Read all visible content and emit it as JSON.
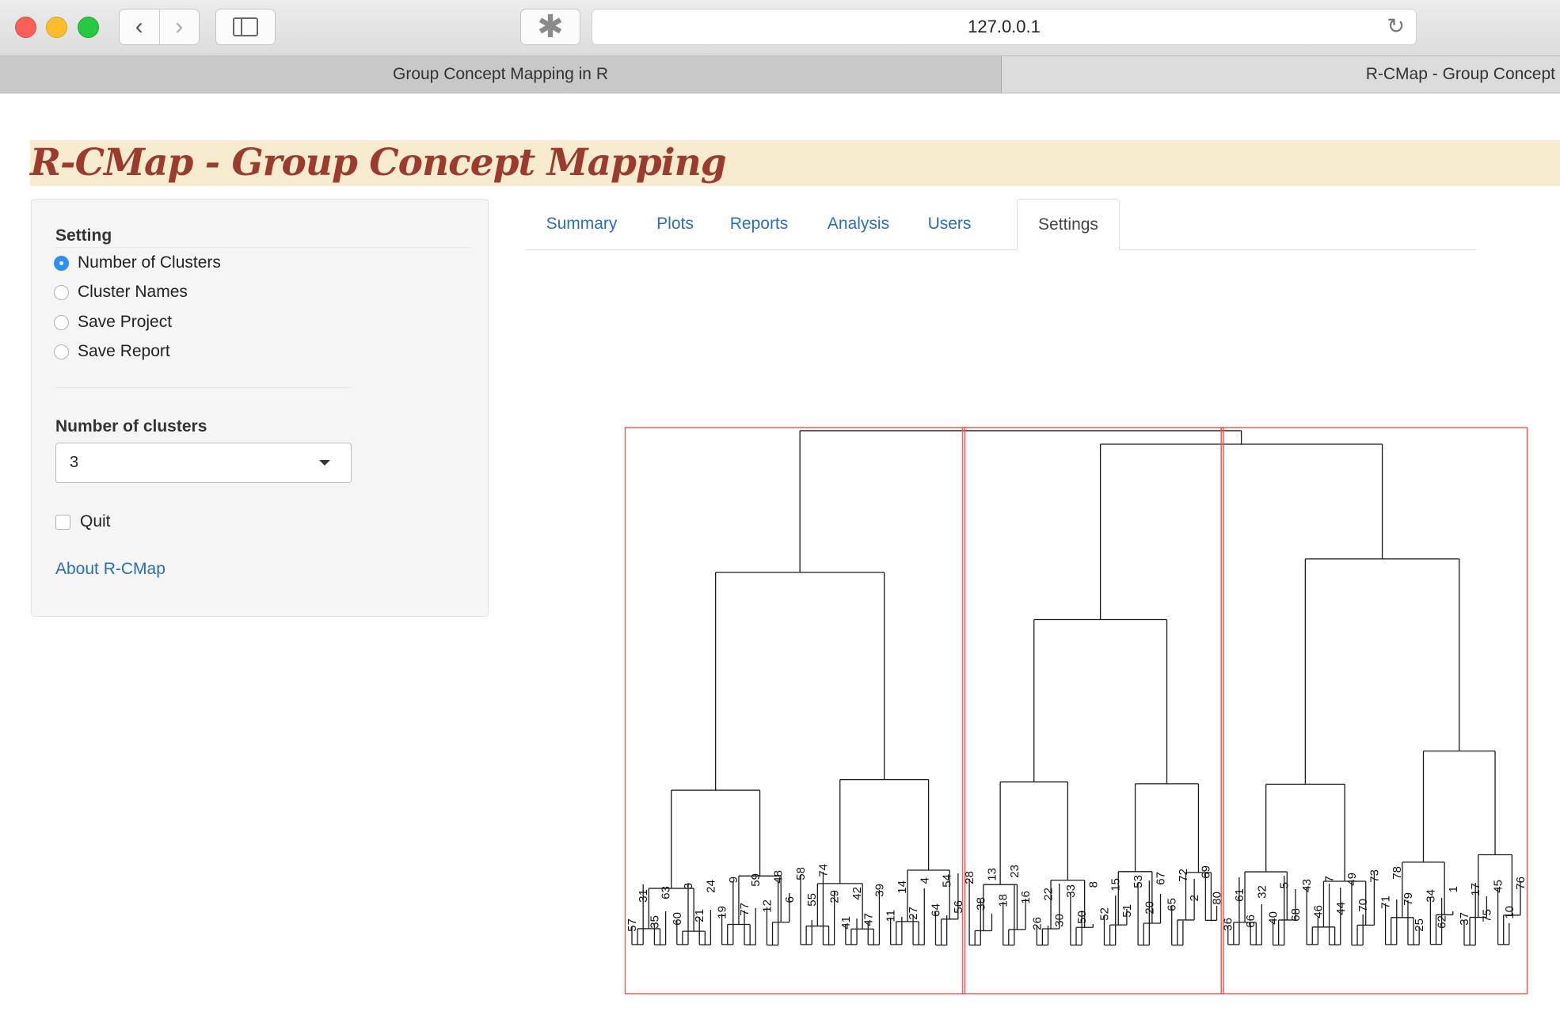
{
  "browser": {
    "url": "127.0.0.1",
    "tabs": [
      "Group Concept Mapping in R",
      "R-CMap - Group Concept"
    ]
  },
  "app": {
    "title": "R-CMap - Group Concept Mapping"
  },
  "sidebar": {
    "setting_label": "Setting",
    "options": [
      {
        "label": "Number of Clusters",
        "selected": true
      },
      {
        "label": "Cluster Names",
        "selected": false
      },
      {
        "label": "Save Project",
        "selected": false
      },
      {
        "label": "Save Report",
        "selected": false
      }
    ],
    "clusters_label": "Number of clusters",
    "clusters_value": "3",
    "quit_label": "Quit",
    "quit_checked": false,
    "about_link": "About R-CMap"
  },
  "tabs": [
    {
      "label": "Summary",
      "active": false
    },
    {
      "label": "Plots",
      "active": false
    },
    {
      "label": "Reports",
      "active": false
    },
    {
      "label": "Analysis",
      "active": false
    },
    {
      "label": "Users",
      "active": false
    },
    {
      "label": "Settings",
      "active": true
    }
  ],
  "dendrogram": {
    "leaf_labels": [
      "57",
      "31",
      "35",
      "63",
      "60",
      "3",
      "21",
      "24",
      "19",
      "9",
      "77",
      "59",
      "12",
      "48",
      "6",
      "58",
      "55",
      "74",
      "29",
      "41",
      "42",
      "47",
      "39",
      "11",
      "14",
      "27",
      "4",
      "64",
      "54",
      "56",
      "28",
      "38",
      "13",
      "18",
      "23",
      "16",
      "26",
      "22",
      "30",
      "33",
      "50",
      "8",
      "52",
      "15",
      "51",
      "53",
      "20",
      "67",
      "65",
      "72",
      "2",
      "69",
      "80",
      "36",
      "61",
      "66",
      "32",
      "40",
      "5",
      "68",
      "43",
      "46",
      "7",
      "44",
      "49",
      "70",
      "73",
      "71",
      "78",
      "79",
      "25",
      "34",
      "62",
      "1",
      "37",
      "17",
      "75",
      "45",
      "10",
      "76"
    ],
    "clusters": 3,
    "cluster_sizes": [
      30,
      23,
      27
    ],
    "colors": {
      "links": "#1a1a1a",
      "cluster_boxes": "#f05a5a"
    }
  },
  "icons": {
    "back": "chevron-left-icon",
    "forward": "chevron-right-icon",
    "sidebar": "sidebar-icon",
    "extension": "extension-icon",
    "reload": "reload-icon",
    "select_caret": "caret-down-icon"
  }
}
